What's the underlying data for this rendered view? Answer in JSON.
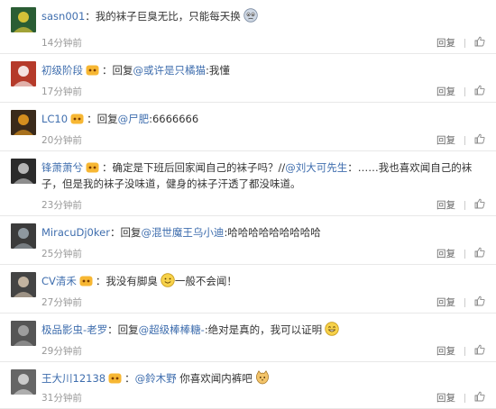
{
  "comments": [
    {
      "user": "sasn001",
      "badge": false,
      "sep": "：",
      "parts": [
        {
          "t": "text",
          "v": "我的袜子巨臭无比，只能每天换"
        }
      ],
      "emoji": "sad-face",
      "time": "14分钟前",
      "reply": "回复"
    },
    {
      "user": "初级阶段",
      "badge": true,
      "sep": "：",
      "parts": [
        {
          "t": "text",
          "v": "回复"
        },
        {
          "t": "mention",
          "v": "@或许是只橘猫"
        },
        {
          "t": "text",
          "v": ":我懂"
        }
      ],
      "time": "17分钟前",
      "reply": "回复"
    },
    {
      "user": "LC10",
      "badge": true,
      "sep": "：",
      "parts": [
        {
          "t": "text",
          "v": "回复"
        },
        {
          "t": "mention",
          "v": "@尸肥"
        },
        {
          "t": "text",
          "v": ":6666666"
        }
      ],
      "time": "20分钟前",
      "reply": "回复"
    },
    {
      "user": "锋萧萧兮",
      "badge": true,
      "sep": "：",
      "parts": [
        {
          "t": "text",
          "v": "确定是下班后回家闻自己的袜子吗？//"
        },
        {
          "t": "mention",
          "v": "@刘大可先生"
        },
        {
          "t": "text",
          "v": "：……我也喜欢闻自己的袜子，但是我的袜子没味道，健身的袜子汗透了都没味道。"
        }
      ],
      "time": "23分钟前",
      "reply": "回复"
    },
    {
      "user": "MiracuDj0ker",
      "badge": false,
      "sep": "：",
      "parts": [
        {
          "t": "text",
          "v": "回复"
        },
        {
          "t": "mention",
          "v": "@混世魔王乌小迪"
        },
        {
          "t": "text",
          "v": ":哈哈哈哈哈哈哈哈哈"
        }
      ],
      "time": "25分钟前",
      "reply": "回复"
    },
    {
      "user": "CV清禾",
      "badge": true,
      "sep": "：",
      "parts": [
        {
          "t": "text",
          "v": "我没有脚臭"
        }
      ],
      "emoji": "smile-face",
      "after": "一般不会闻！",
      "time": "27分钟前",
      "reply": "回复"
    },
    {
      "user": "极品影虫-老罗",
      "badge": false,
      "sep": "：",
      "parts": [
        {
          "t": "text",
          "v": "回复"
        },
        {
          "t": "mention",
          "v": "@超级棒棒糖-"
        },
        {
          "t": "text",
          "v": ":绝对是真的，我可以证明"
        }
      ],
      "emoji": "grin-face",
      "time": "29分钟前",
      "reply": "回复"
    },
    {
      "user": "王大川12138",
      "badge": true,
      "sep": "：",
      "parts": [
        {
          "t": "mention",
          "v": "@鈴木野"
        },
        {
          "t": "text",
          "v": " 你喜欢闻内裤吧"
        }
      ],
      "emoji": "cat-face",
      "time": "31分钟前",
      "reply": "回复"
    }
  ]
}
